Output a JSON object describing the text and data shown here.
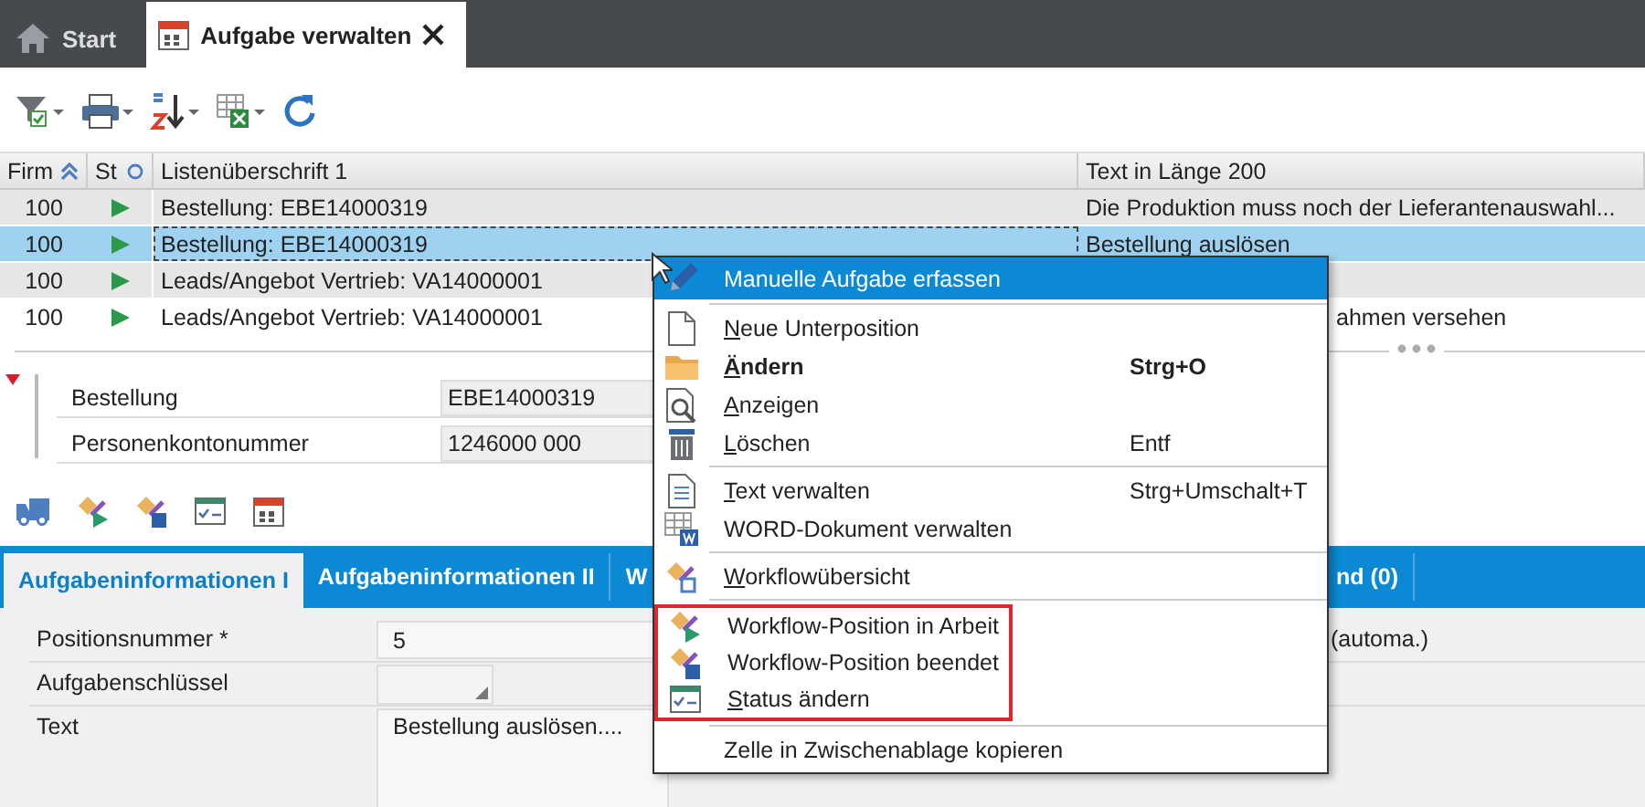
{
  "tabs": [
    {
      "label": "Start",
      "selected": false
    },
    {
      "label": "Aufgabe verwalten",
      "selected": true
    }
  ],
  "table": {
    "columns": [
      "Firm",
      "St",
      "Listenüberschrift 1",
      "Text in Länge 200"
    ],
    "rows": [
      {
        "firm": "100",
        "title": "Bestellung: EBE14000319",
        "text": "Die Produktion muss noch der Lieferantenauswahl...",
        "selected": false
      },
      {
        "firm": "100",
        "title": "Bestellung: EBE14000319",
        "text": "Bestellung auslösen",
        "selected": true
      },
      {
        "firm": "100",
        "title": "Leads/Angebot Vertrieb: VA14000001",
        "selected": false
      },
      {
        "firm": "100",
        "title": "Leads/Angebot Vertrieb: VA14000001",
        "text": "ahmen versehen",
        "partly_hidden": true,
        "selected": false
      }
    ]
  },
  "details": {
    "fields": [
      {
        "label": "Bestellung",
        "value": "EBE14000319"
      },
      {
        "label": "Personenkontonummer",
        "value": "1246000 000"
      }
    ]
  },
  "detail_tabs": [
    {
      "label": "Aufgabeninformationen I",
      "selected": true
    },
    {
      "label": "Aufgabeninformationen II",
      "selected": false
    },
    {
      "label": "W",
      "selected": false
    },
    {
      "label": "nd (0)",
      "selected": false,
      "partly_hidden": true
    }
  ],
  "form": {
    "fields": [
      {
        "kind": "input",
        "label": "Positionsnummer *",
        "value": "5",
        "note": "(automa.)"
      },
      {
        "kind": "dropdown",
        "label": "Aufgabenschlüssel"
      },
      {
        "kind": "textarea",
        "label": "Text",
        "value": "Bestellung auslösen...."
      }
    ]
  },
  "context_menu": {
    "sections": [
      {
        "marked": false,
        "items": [
          {
            "label": "Manuelle Aufgabe erfassen",
            "selected": true,
            "underline_first": false,
            "bold": false
          }
        ]
      },
      {
        "marked": false,
        "items": [
          {
            "label": "Neue Unterposition",
            "selected": false,
            "underline_first": true,
            "bold": false
          },
          {
            "label": "Ändern",
            "shortcut": "Strg+O",
            "selected": false,
            "underline_first": true,
            "bold": true
          },
          {
            "label": "Anzeigen",
            "selected": false,
            "underline_first": true,
            "bold": false
          },
          {
            "label": "Löschen",
            "shortcut": "Entf",
            "selected": false,
            "underline_first": true,
            "bold": false
          }
        ]
      },
      {
        "marked": false,
        "items": [
          {
            "label": "Text verwalten",
            "shortcut": "Strg+Umschalt+T",
            "selected": false,
            "underline_first": true,
            "bold": false
          },
          {
            "label": "WORD-Dokument verwalten",
            "selected": false,
            "underline_first": false,
            "bold": false
          }
        ]
      },
      {
        "marked": false,
        "items": [
          {
            "label": "Workflowübersicht",
            "selected": false,
            "underline_first": true,
            "bold": false
          }
        ]
      },
      {
        "marked": true,
        "items": [
          {
            "label": "Workflow-Position in Arbeit",
            "selected": false,
            "underline_first": false,
            "bold": false
          },
          {
            "label": "Workflow-Position beendet",
            "selected": false,
            "underline_first": false,
            "bold": false
          },
          {
            "label": "Status ändern",
            "selected": false,
            "underline_first": true,
            "bold": false
          }
        ]
      },
      {
        "marked": false,
        "items": [
          {
            "label": "Zelle in Zwischenablage kopieren",
            "selected": false,
            "underline_first": false,
            "bold": false
          }
        ]
      }
    ]
  }
}
